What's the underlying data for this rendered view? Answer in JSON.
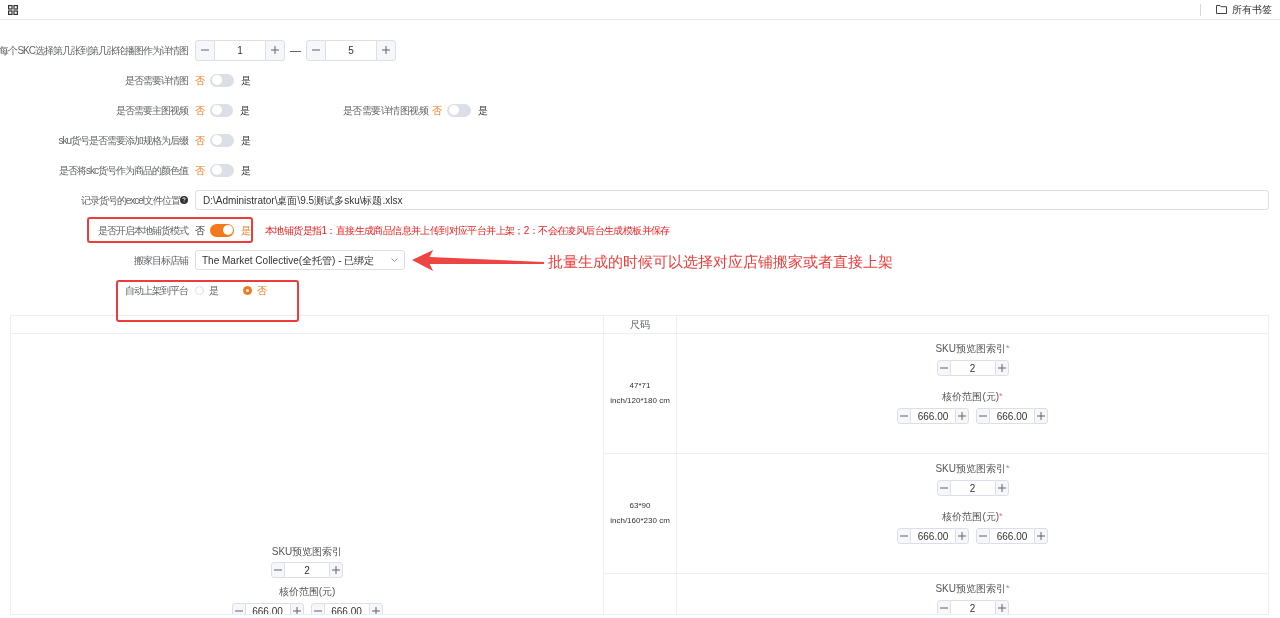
{
  "top_bar": {
    "bookmarks": "所有书签"
  },
  "form_rows": [
    {
      "highlighted": false,
      "fields": [
        {
          "kind": "range",
          "label": "每个SKC选择第几张到第几张轮播图作为详情图",
          "from": "1",
          "separator": "—",
          "to": "5"
        }
      ]
    },
    {
      "highlighted": false,
      "fields": [
        {
          "kind": "switch",
          "label": "是否需要详情图",
          "off_label": "否",
          "on_label": "是",
          "on": false
        }
      ]
    },
    {
      "highlighted": false,
      "fields": [
        {
          "kind": "switch",
          "label": "是否需要主图视频",
          "off_label": "否",
          "on_label": "是",
          "on": false
        },
        {
          "kind": "switch",
          "label": "是否需要详情图视频",
          "off_label": "否",
          "on_label": "是",
          "on": false
        }
      ]
    },
    {
      "highlighted": false,
      "fields": [
        {
          "kind": "switch",
          "label": "sku货号是否需要添加规格为后缀",
          "off_label": "否",
          "on_label": "是",
          "on": false
        }
      ]
    },
    {
      "highlighted": false,
      "fields": [
        {
          "kind": "switch",
          "label": "是否将skc货号作为商品的颜色值",
          "off_label": "否",
          "on_label": "是",
          "on": false
        }
      ]
    },
    {
      "highlighted": false,
      "fields": [
        {
          "kind": "path",
          "label": "记录货号的excel文件位置",
          "value": "D:\\Administrator\\桌面\\9.5测试多sku\\标题.xlsx"
        }
      ]
    },
    {
      "highlighted": true,
      "fields": [
        {
          "kind": "switch",
          "label": "是否开启本地铺货模式",
          "off_label": "否",
          "on_label": "是",
          "on": true
        }
      ],
      "note": "本地铺货是指1：直接生成商品信息并上传到对应平台并上架；2：不会在凌风后台生成模板并保存"
    },
    {
      "highlighted": false,
      "fields": [
        {
          "kind": "select",
          "label": "搬家目标店铺",
          "value": "The Market Collective(全托管) - 已绑定"
        }
      ],
      "callout": "批量生成的时候可以选择对应店铺搬家或者直接上架"
    },
    {
      "highlighted": true,
      "fields": [
        {
          "kind": "radio",
          "label": "自动上架到平台",
          "options": [
            {
              "label": "是",
              "selected": false
            },
            {
              "label": "否",
              "selected": true
            }
          ]
        }
      ]
    }
  ],
  "table": {
    "size_heading": "尺码",
    "shared": {
      "index_label": "SKU预览图索引",
      "index": "2",
      "price_label": "核价范围(元)",
      "price_min": "666.00",
      "price_max": "666.00"
    },
    "rows": [
      {
        "size": "47*71",
        "size_unit": "inch/120*180 cm",
        "index_label": "SKU预览图索引",
        "required_mark": "*",
        "index": "2",
        "price_label": "核价范围(元)",
        "price_required_mark": "*",
        "price_min": "666.00",
        "price_max": "666.00"
      },
      {
        "size": "63*90",
        "size_unit": "inch/160*230 cm",
        "index_label": "SKU预览图索引",
        "required_mark": "*",
        "index": "2",
        "price_label": "核价范围(元)",
        "price_required_mark": "*",
        "price_min": "666.00",
        "price_max": "666.00"
      },
      {
        "index_label": "SKU预览图索引",
        "required_mark": "*",
        "index": "2"
      }
    ]
  }
}
